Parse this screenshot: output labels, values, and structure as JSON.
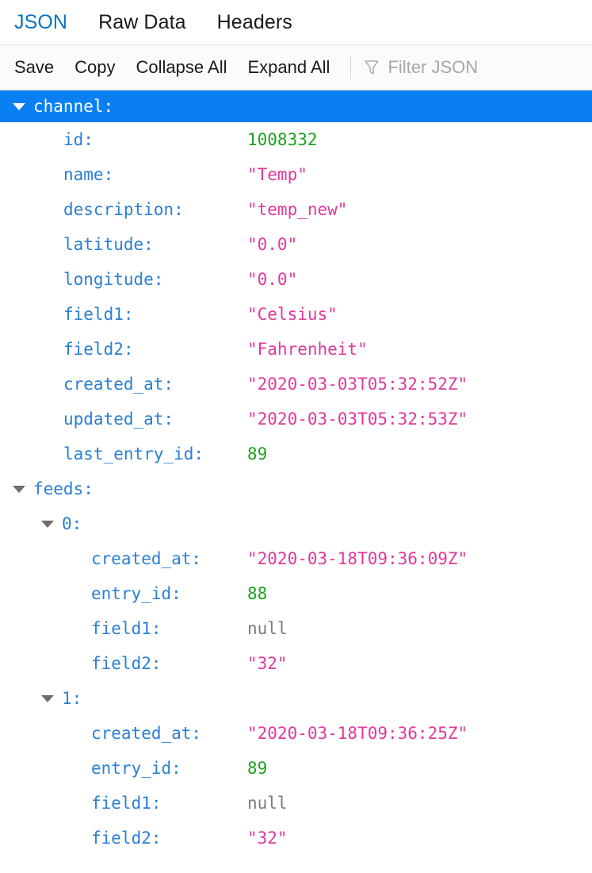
{
  "tabs": [
    {
      "label": "JSON",
      "active": true
    },
    {
      "label": "Raw Data",
      "active": false
    },
    {
      "label": "Headers",
      "active": false
    }
  ],
  "toolbar": {
    "save_label": "Save",
    "copy_label": "Copy",
    "collapse_all_label": "Collapse All",
    "expand_all_label": "Expand All",
    "filter_placeholder": "Filter JSON",
    "filter_value": "",
    "filter_icon": "funnel-icon"
  },
  "colors": {
    "accent": "#1b8ae6",
    "selection": "#0a7ff2",
    "key": "#2a7fd4",
    "string": "#e0399c",
    "number": "#1ca21c",
    "null": "#7a7a7a"
  },
  "tree": [
    {
      "level": 0,
      "twisty": "down",
      "key": "channel:",
      "selected": true
    },
    {
      "level": 1,
      "key": "id:",
      "value": "1008332",
      "type": "num"
    },
    {
      "level": 1,
      "key": "name:",
      "value": "\"Temp\"",
      "type": "str"
    },
    {
      "level": 1,
      "key": "description:",
      "value": "\"temp_new\"",
      "type": "str"
    },
    {
      "level": 1,
      "key": "latitude:",
      "value": "\"0.0\"",
      "type": "str"
    },
    {
      "level": 1,
      "key": "longitude:",
      "value": "\"0.0\"",
      "type": "str"
    },
    {
      "level": 1,
      "key": "field1:",
      "value": "\"Celsius\"",
      "type": "str"
    },
    {
      "level": 1,
      "key": "field2:",
      "value": "\"Fahrenheit\"",
      "type": "str"
    },
    {
      "level": 1,
      "key": "created_at:",
      "value": "\"2020-03-03T05:32:52Z\"",
      "type": "str"
    },
    {
      "level": 1,
      "key": "updated_at:",
      "value": "\"2020-03-03T05:32:53Z\"",
      "type": "str"
    },
    {
      "level": 1,
      "key": "last_entry_id:",
      "value": "89",
      "type": "num"
    },
    {
      "level": 0,
      "twisty": "down",
      "key": "feeds:"
    },
    {
      "level": 1,
      "twisty": "down",
      "key": "0:",
      "obj": true
    },
    {
      "level": 2,
      "key": "created_at:",
      "value": "\"2020-03-18T09:36:09Z\"",
      "type": "str"
    },
    {
      "level": 2,
      "key": "entry_id:",
      "value": "88",
      "type": "num"
    },
    {
      "level": 2,
      "key": "field1:",
      "value": "null",
      "type": "null"
    },
    {
      "level": 2,
      "key": "field2:",
      "value": "\"32\"",
      "type": "str"
    },
    {
      "level": 1,
      "twisty": "down",
      "key": "1:",
      "obj": true
    },
    {
      "level": 2,
      "key": "created_at:",
      "value": "\"2020-03-18T09:36:25Z\"",
      "type": "str"
    },
    {
      "level": 2,
      "key": "entry_id:",
      "value": "89",
      "type": "num"
    },
    {
      "level": 2,
      "key": "field1:",
      "value": "null",
      "type": "null"
    },
    {
      "level": 2,
      "key": "field2:",
      "value": "\"32\"",
      "type": "str"
    }
  ]
}
